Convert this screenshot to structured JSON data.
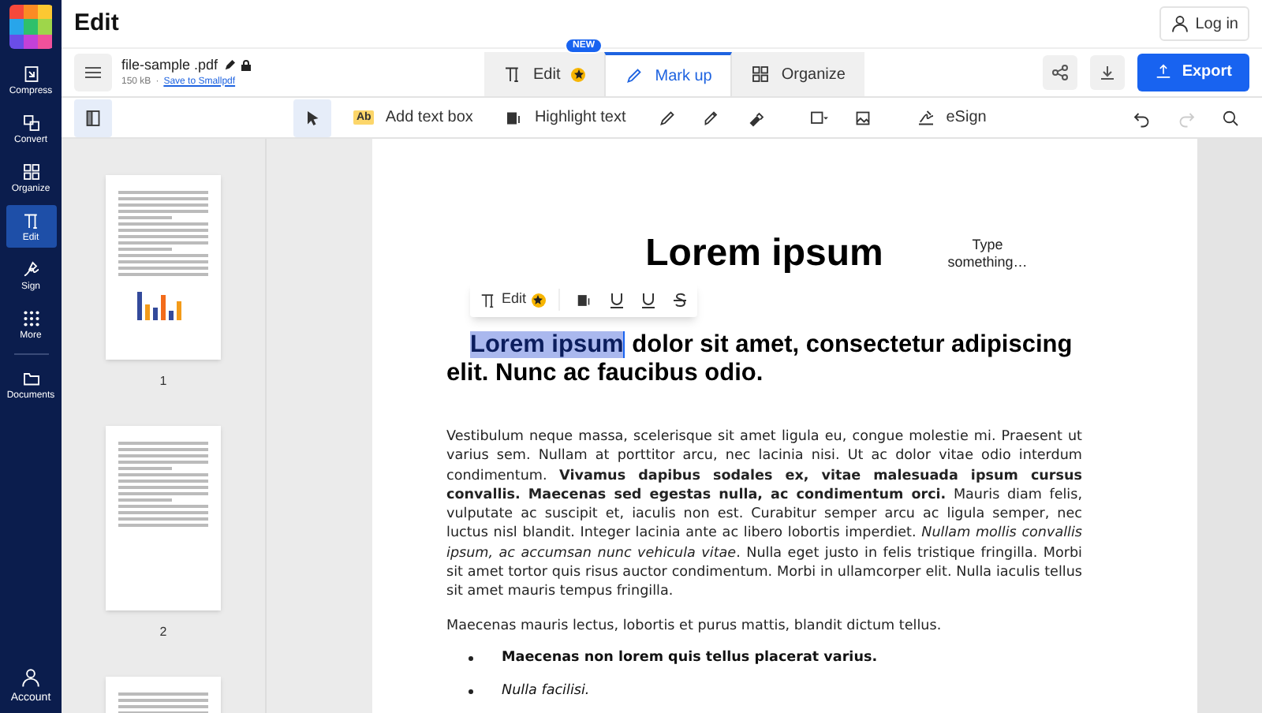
{
  "app": {
    "title": "Edit",
    "login": "Log in"
  },
  "nav": [
    {
      "label": "Compress",
      "selected": false
    },
    {
      "label": "Convert",
      "selected": false
    },
    {
      "label": "Organize",
      "selected": false
    },
    {
      "label": "Edit",
      "selected": true
    },
    {
      "label": "Sign",
      "selected": false
    },
    {
      "label": "More",
      "selected": false
    },
    {
      "label": "Documents",
      "selected": false
    }
  ],
  "account": {
    "label": "Account"
  },
  "file": {
    "name": "file-sample .pdf",
    "size": "150 kB",
    "separator": "·",
    "save_link": "Save to Smallpdf"
  },
  "tabs": [
    {
      "label": "Edit",
      "badge": "NEW",
      "premium": true,
      "selected": false
    },
    {
      "label": "Mark up",
      "premium": false,
      "selected": true
    },
    {
      "label": "Organize",
      "premium": false,
      "selected": false
    }
  ],
  "export": {
    "label": "Export"
  },
  "toolbar": [
    {
      "kind": "icon",
      "selected": true,
      "disabled": false
    },
    {
      "kind": "icon",
      "selected": true,
      "disabled": false
    },
    {
      "kind": "labeled",
      "glyph": "Ab",
      "label": "Add text box",
      "selected": false,
      "disabled": false
    },
    {
      "kind": "labeled",
      "label": "Highlight text",
      "selected": false,
      "disabled": false
    },
    {
      "kind": "icon",
      "selected": false,
      "disabled": false
    },
    {
      "kind": "icon",
      "selected": false,
      "disabled": false
    },
    {
      "kind": "icon",
      "selected": false,
      "disabled": false
    },
    {
      "kind": "icon",
      "selected": false,
      "disabled": false
    },
    {
      "kind": "icon",
      "selected": false,
      "disabled": false
    },
    {
      "kind": "labeled",
      "label": "eSign",
      "selected": false,
      "disabled": false
    },
    {
      "kind": "icon",
      "selected": false,
      "disabled": false
    },
    {
      "kind": "icon",
      "selected": false,
      "disabled": true
    },
    {
      "kind": "icon",
      "selected": false,
      "disabled": false
    }
  ],
  "thumbnails": [
    {
      "page": "1"
    },
    {
      "page": "2"
    }
  ],
  "document": {
    "title": "Lorem ipsum",
    "text_box": "Type something…",
    "mini_toolbar": {
      "edit": "Edit"
    },
    "heading": [
      {
        "text": "Lorem ipsum",
        "selected": true
      },
      {
        "text": " dolor sit amet, consectetur adipiscing elit. Nunc ac faucibus odio.",
        "selected": false
      }
    ],
    "paragraphs": [
      "Vestibulum neque massa, scelerisque sit amet ligula eu, congue molestie mi. Praesent ut varius sem. Nullam at porttitor arcu, nec lacinia nisi. Ut ac dolor vitae odio interdum condimentum. **Vivamus dapibus sodales ex, vitae malesuada ipsum cursus convallis. Maecenas sed egestas nulla, ac condimentum orci.** Mauris diam felis, vulputate ac suscipit et, iaculis non est. Curabitur semper arcu ac ligula semper, nec luctus nisl blandit. Integer lacinia ante ac libero lobortis imperdiet. *Nullam mollis convallis ipsum, ac accumsan nunc vehicula vitae*. Nulla eget justo in felis tristique fringilla. Morbi sit amet tortor quis risus auctor condimentum. Morbi in ullamcorper elit. Nulla iaculis tellus sit amet mauris tempus fringilla.",
      "Maecenas mauris lectus, lobortis et purus mattis, blandit dictum tellus."
    ],
    "bullets": [
      {
        "text": "Maecenas non lorem quis tellus placerat varius.",
        "bold": true,
        "italic": false
      },
      {
        "text": "Nulla facilisi.",
        "bold": false,
        "italic": true
      }
    ]
  }
}
